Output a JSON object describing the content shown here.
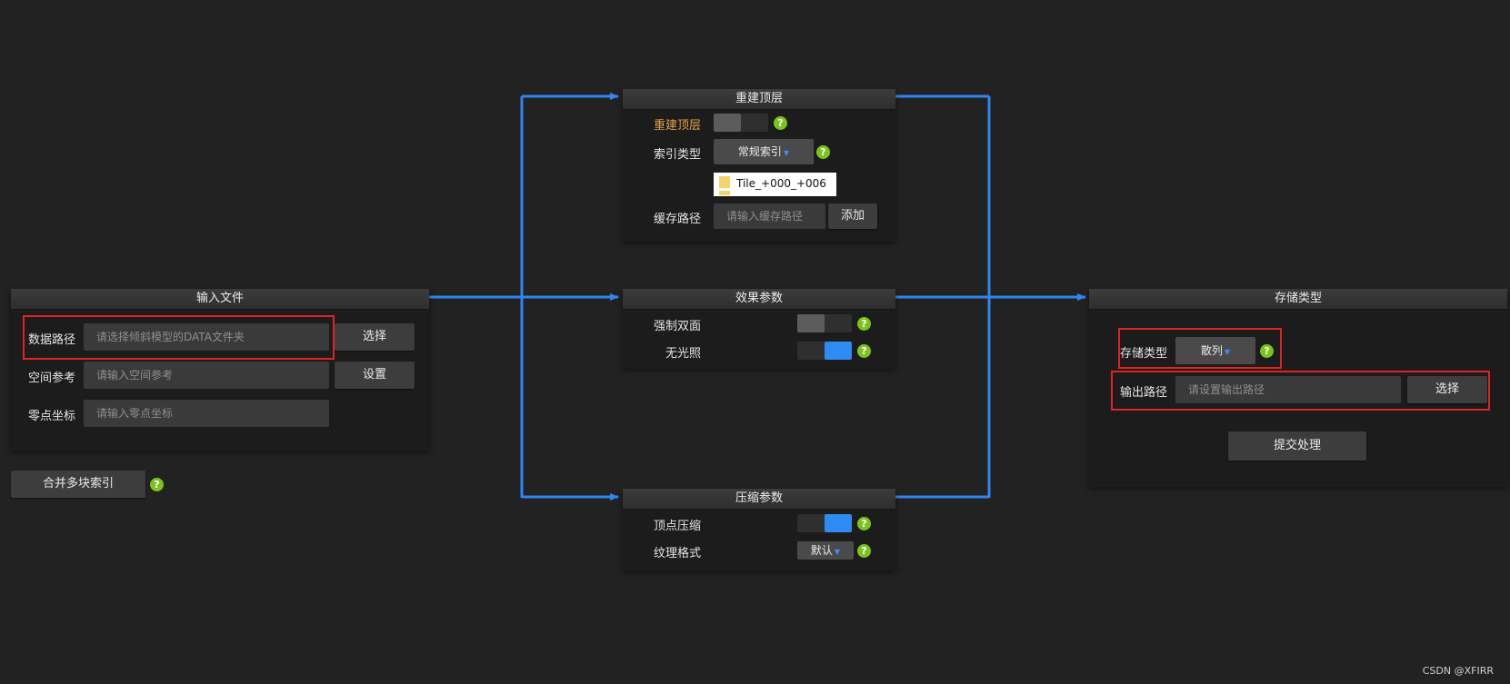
{
  "input_panel": {
    "title": "输入文件",
    "data_path": {
      "label": "数据路径",
      "placeholder": "请选择倾斜模型的DATA文件夹",
      "button": "选择"
    },
    "spatial_ref": {
      "label": "空间参考",
      "placeholder": "请输入空间参考",
      "button": "设置"
    },
    "origin": {
      "label": "零点坐标",
      "placeholder": "请输入零点坐标"
    }
  },
  "merge_button": "合并多块索引",
  "rebuild_panel": {
    "title": "重建顶层",
    "rebuild": {
      "label": "重建顶层",
      "toggle": "off"
    },
    "index_type": {
      "label": "索引类型",
      "value": "常规索引"
    },
    "popup_item": "Tile_+000_+006",
    "cache_path": {
      "label": "缓存路径",
      "placeholder": "请输入缓存路径",
      "button": "添加"
    }
  },
  "effect_panel": {
    "title": "效果参数",
    "double_side": {
      "label": "强制双面",
      "toggle": "off"
    },
    "no_light": {
      "label": "无光照",
      "toggle": "on"
    }
  },
  "compress_panel": {
    "title": "压缩参数",
    "vertex": {
      "label": "顶点压缩",
      "toggle": "on"
    },
    "texture": {
      "label": "纹理格式",
      "value": "默认"
    }
  },
  "storage_panel": {
    "title": "存储类型",
    "storage_type": {
      "label": "存储类型",
      "value": "散列"
    },
    "output_path": {
      "label": "输出路径",
      "placeholder": "请设置输出路径",
      "button": "选择"
    },
    "submit": "提交处理"
  },
  "help_glyph": "?",
  "caret_glyph": "▼",
  "watermark": "CSDN @XFIRR",
  "colors": {
    "background": "#222222",
    "panel": "#1c1c1c",
    "connector": "#2f86f0",
    "toggle_on": "#2e8bf4",
    "help": "#7dc21d",
    "highlight": "#e02424",
    "accent_label": "#e2a24a"
  }
}
